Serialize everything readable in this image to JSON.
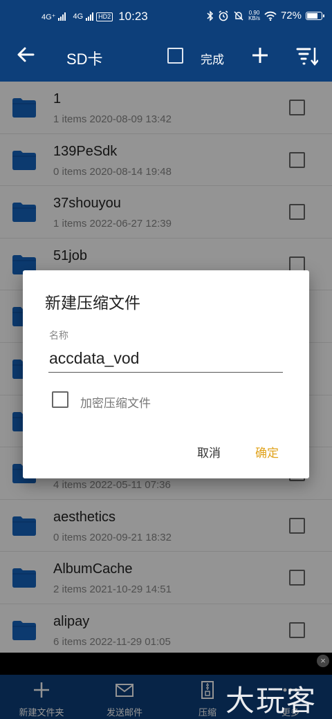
{
  "status_bar": {
    "net1": "4G⁺",
    "net2": "4G",
    "hd": "HD",
    "hd_sub": "2",
    "time": "10:23",
    "speed_value": "0.90",
    "speed_unit": "KB/s",
    "battery": "72%",
    "icons": [
      "bluetooth-icon",
      "alarm-icon",
      "mute-icon",
      "wifi-icon",
      "battery-icon"
    ]
  },
  "toolbar": {
    "title": "SD卡",
    "done_label": "完成",
    "icons": [
      "back-arrow-icon",
      "select-all-checkbox",
      "add-icon",
      "sort-icon"
    ]
  },
  "files": [
    {
      "name": "1",
      "meta": "1 items 2020-08-09 13:42"
    },
    {
      "name": "139PeSdk",
      "meta": "0 items 2020-08-14 19:48"
    },
    {
      "name": "37shouyou",
      "meta": "1 items 2022-06-27 12:39"
    },
    {
      "name": "51job",
      "meta": ""
    },
    {
      "name": "",
      "meta": ""
    },
    {
      "name": "",
      "meta": ""
    },
    {
      "name": "",
      "meta": ""
    },
    {
      "name": "",
      "meta": "4 items 2022-05-11 07:36"
    },
    {
      "name": "aesthetics",
      "meta": "0 items 2020-09-21 18:32"
    },
    {
      "name": "AlbumCache",
      "meta": "2 items 2021-10-29 14:51"
    },
    {
      "name": "alipay",
      "meta": "6 items 2022-11-29 01:05"
    }
  ],
  "dialog": {
    "title": "新建压缩文件",
    "name_label": "名称",
    "name_value": "accdata_vod",
    "encrypt_label": "加密压缩文件",
    "cancel_label": "取消",
    "ok_label": "确定"
  },
  "bottom_bar": {
    "items": [
      {
        "label": "新建文件夹",
        "icon": "add-icon"
      },
      {
        "label": "发送邮件",
        "icon": "mail-icon"
      },
      {
        "label": "压缩",
        "icon": "zip-icon"
      },
      {
        "label": "更多",
        "icon": "more-icon"
      }
    ]
  },
  "watermark": "大玩客",
  "colors": {
    "primary": "#0d3f7a",
    "folder": "#1565c0",
    "accent": "#e0a21a"
  }
}
